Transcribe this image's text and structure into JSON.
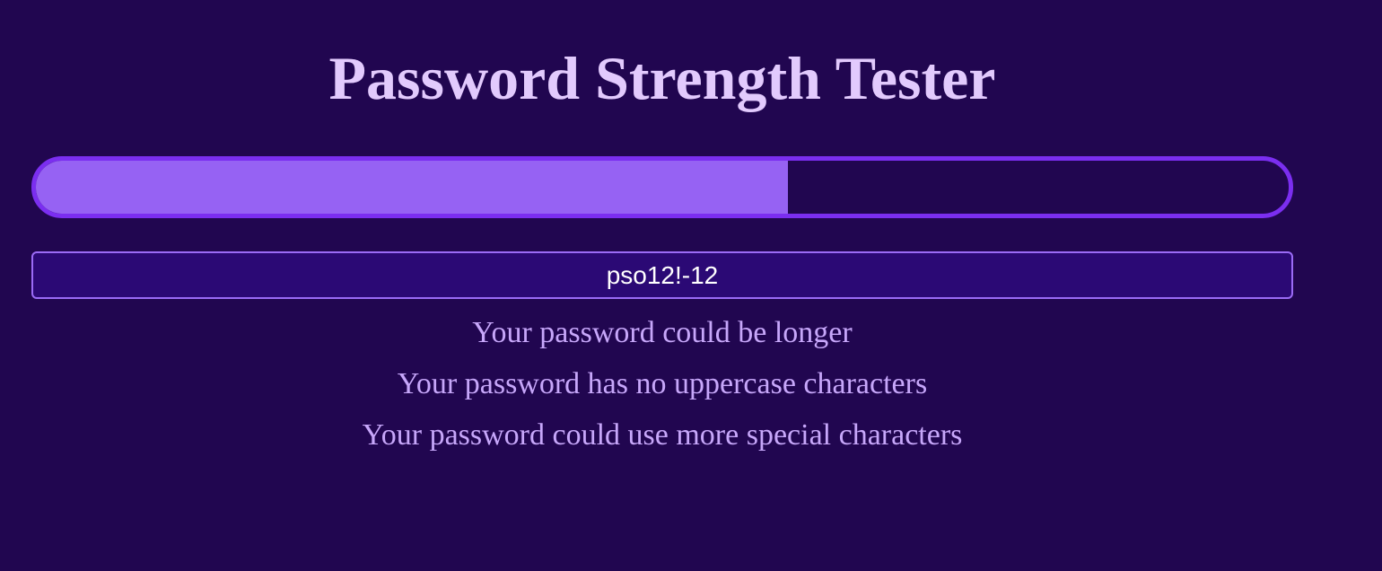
{
  "page": {
    "title": "Password Strength Tester"
  },
  "strength": {
    "fraction": 0.6,
    "fill_color": "#9662f3",
    "track_border_color": "#7b2ef0"
  },
  "password_field": {
    "value": "pso12!-12"
  },
  "reasons": [
    "Your password could be longer",
    "Your password has no uppercase characters",
    "Your password could use more special characters"
  ],
  "colors": {
    "background": "#210650",
    "title": "#e2cafd",
    "reason_text": "#c7a7fa",
    "input_background": "#2b0975",
    "input_border": "#9b6bf6"
  }
}
